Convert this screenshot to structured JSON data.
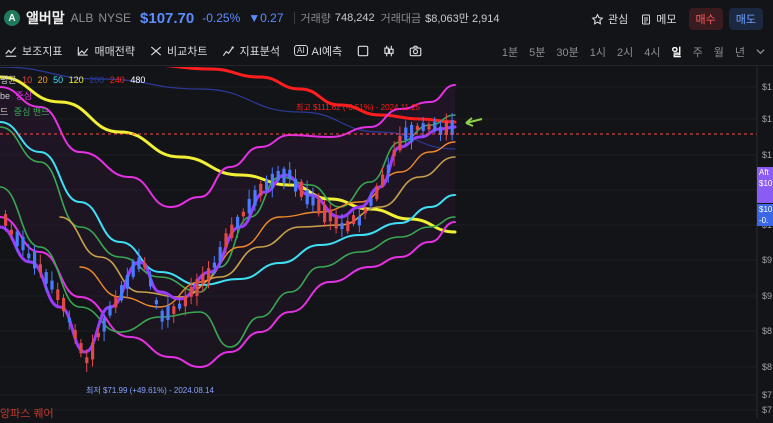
{
  "stock": {
    "logo_letter": "A",
    "name": "앨버말",
    "ticker": "ALB",
    "exchange": "NYSE",
    "price": "$107.70",
    "change_pct": "-0.25%",
    "change_abs": "▼0.27",
    "volume_label": "거래량",
    "volume_value": "748,242",
    "amount_label": "거래대금",
    "amount_value": "$8,063만 2,914"
  },
  "actions": {
    "watch_label": "관심",
    "memo_label": "메모",
    "buy_label": "매수",
    "sell_label": "매도"
  },
  "toolbar": {
    "indicators": "보조지표",
    "strategy": "매매전략",
    "compare": "비교차트",
    "indicator_analysis": "지표분석",
    "ai_badge": "AI",
    "ai_forecast": "AI예측"
  },
  "periods": [
    "1분",
    "5분",
    "30분",
    "1시",
    "2시",
    "4시",
    "일",
    "주",
    "월",
    "년"
  ],
  "active_period": "일",
  "legend": {
    "ma_label": "평균",
    "ma_values": [
      "20",
      "50",
      "120",
      "200",
      "240",
      "480"
    ],
    "ma_values_prefix": "10",
    "band1_label": "be",
    "band1_center": "중심",
    "band2_label": "드",
    "band2_center": "중심 밴드"
  },
  "annotations": {
    "high": "최고 $111.62 (-3.51%) - 2024.11.25",
    "low": "최저 $71.99 (+49.61%) - 2024.08.14",
    "bottom_text": "앙파스 퀘어"
  },
  "price_tags": {
    "after_label": "Aft",
    "after_price": "$10",
    "current_price": "$10",
    "current_change": "-0."
  },
  "y_axis_labels": [
    "$1",
    "$1",
    "$1",
    "$1",
    "$1",
    "$9",
    "$9",
    "$8",
    "$8",
    "$7",
    "$7"
  ],
  "colors": {
    "up": "#e24848",
    "down": "#4a7bff",
    "price_blue": "#5b8cff",
    "ma_red": "#ff1e1e",
    "ma_yellow": "#f1f035",
    "ma_cyan": "#3ee0f5",
    "ma_navy": "#2b3a9a",
    "bb_green": "#39a852",
    "bb_magenta": "#e431e4",
    "purple_line": "#9a3bff",
    "orange_line": "#f08a2a",
    "tan_line": "#c8a24a"
  }
}
